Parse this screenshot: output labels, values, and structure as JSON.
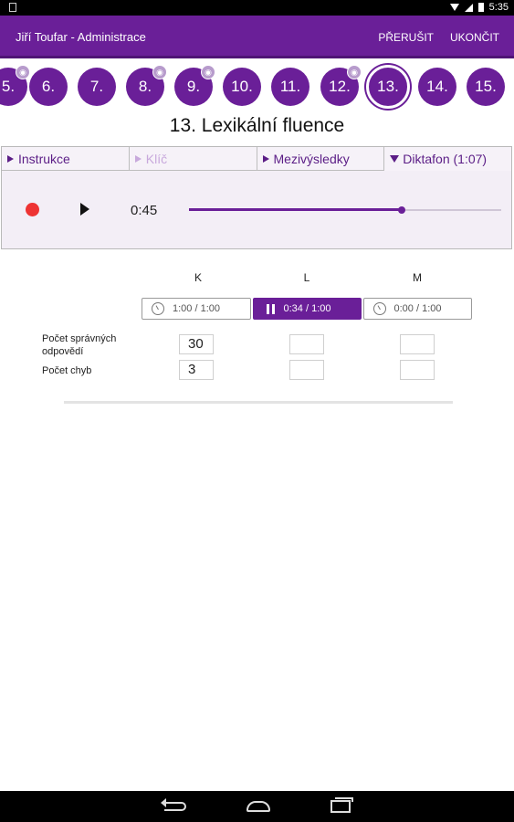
{
  "status_bar": {
    "time": "5:35"
  },
  "app_bar": {
    "title": "Jiří Toufar - Administrace",
    "actions": [
      "PŘERUŠIT",
      "UKONČIT"
    ]
  },
  "question_nav": {
    "items": [
      {
        "label": "5.",
        "has_audio": true
      },
      {
        "label": "6.",
        "has_audio": false
      },
      {
        "label": "7.",
        "has_audio": false
      },
      {
        "label": "8.",
        "has_audio": true
      },
      {
        "label": "9.",
        "has_audio": true
      },
      {
        "label": "10.",
        "has_audio": false
      },
      {
        "label": "11.",
        "has_audio": false
      },
      {
        "label": "12.",
        "has_audio": true
      },
      {
        "label": "13.",
        "has_audio": false
      },
      {
        "label": "14.",
        "has_audio": false
      },
      {
        "label": "15.",
        "has_audio": false
      }
    ],
    "active": "13."
  },
  "page_title": "13. Lexikální fluence",
  "tabs": [
    {
      "label": "Instrukce",
      "state": "collapsed"
    },
    {
      "label": "Klíč",
      "state": "disabled"
    },
    {
      "label": "Mezivýsledky",
      "state": "collapsed"
    },
    {
      "label": "Diktafon (1:07)",
      "state": "expanded"
    }
  ],
  "player": {
    "time": "0:45",
    "progress": 0.68
  },
  "columns": [
    "K",
    "L",
    "M"
  ],
  "timers": [
    {
      "label": "1:00 / 1:00",
      "running": false
    },
    {
      "label": "0:34 / 1:00",
      "running": true
    },
    {
      "label": "0:00 / 1:00",
      "running": false
    }
  ],
  "rows": [
    {
      "label": "Počet správných odpovědí",
      "values": [
        "30",
        "",
        ""
      ]
    },
    {
      "label": "Počet chyb",
      "values": [
        "3",
        "",
        ""
      ]
    }
  ],
  "colors": {
    "accent": "#6a1f98",
    "record": "#ee3333"
  }
}
